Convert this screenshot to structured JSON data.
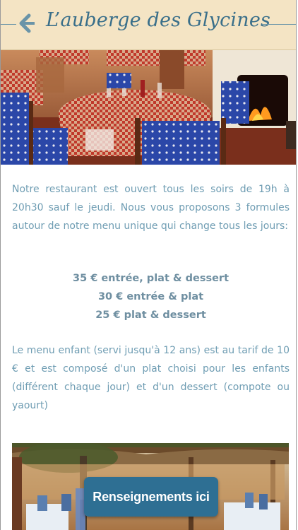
{
  "header": {
    "title": "L’auberge des Glycines",
    "back_icon": "chevron-left-icon",
    "background": "#f4e4c4",
    "title_color": "#3a6f8a"
  },
  "content": {
    "intro": "Notre restaurant est ouvert tous les soirs de 19h à 20h30 sauf le jeudi. Nous vous proposons 3 formules autour de notre menu unique qui change tous les jours:",
    "menus": [
      "35 € entrée, plat & dessert",
      "30 € entrée & plat",
      "25 € plat & dessert"
    ],
    "kids_menu": "Le menu enfant (servi jusqu'à 12 ans) est au tarif de 10 € et est composé d'un plat choisi pour les enfants (différent chaque jour) et d'un dessert (compote ou yaourt)",
    "text_color": "#6f9db3"
  },
  "cta": {
    "label": "Renseignements ici",
    "background": "#2e6f93"
  }
}
